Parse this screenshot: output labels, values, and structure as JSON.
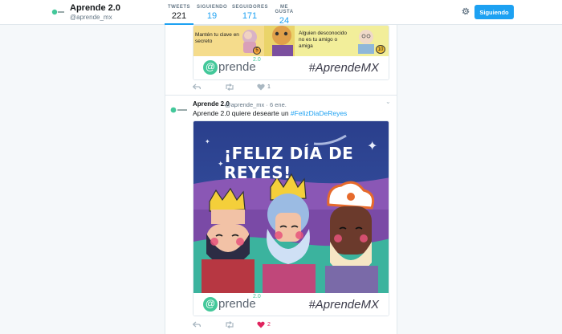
{
  "profile": {
    "name": "Aprende 2.0",
    "handle": "@aprende_mx",
    "avatar_icon": "aprende-logo-icon"
  },
  "stats": [
    {
      "label": "TWEETS",
      "value": "221"
    },
    {
      "label": "SIGUIENDO",
      "value": "19"
    },
    {
      "label": "SEGUIDORES",
      "value": "171"
    },
    {
      "label": "ME GUSTA",
      "value": "24"
    }
  ],
  "header": {
    "gear_icon": "gear-icon",
    "follow_button": "Siguiendo"
  },
  "tweet1": {
    "card": {
      "panel_left": "Mantén tu clave en secreto",
      "panel_left_number": "5",
      "panel_right": "Alguien desconocido no es tu amigo o amiga",
      "panel_right_number": "10"
    },
    "brand": {
      "at": "@",
      "word": "prende",
      "version": "2.0",
      "hashtag": "#AprendeMX"
    },
    "likes": "1"
  },
  "tweet2": {
    "author": "Aprende 2.0",
    "meta": "@aprende_mx · 6 ene.",
    "text_prefix": "Aprende 2.0 quiere desearte un ",
    "hashtag": "#FelizDiaDeReyes",
    "image": {
      "banner": "¡FELIZ DÍA DE REYES!"
    },
    "brand": {
      "at": "@",
      "word": "prende",
      "version": "2.0",
      "hashtag": "#AprendeMX"
    },
    "likes": "2"
  },
  "colors": {
    "accent": "#1da1f2",
    "brand_green": "#43c89a",
    "like_red": "#e0245e"
  }
}
